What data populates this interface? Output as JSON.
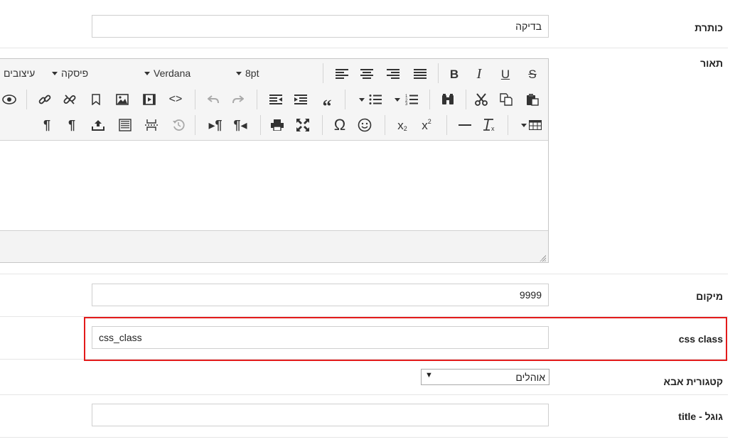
{
  "fields": {
    "title_label": "כותרת",
    "title_value": "בדיקה",
    "description_label": "תאור",
    "position_label": "מיקום",
    "position_value": "9999",
    "css_label": "css class",
    "css_value": "css_class",
    "parent_label": "קטגורית אבא",
    "parent_value": "אוהלים",
    "google_label": "גוגל - title",
    "google_value": ""
  },
  "editor": {
    "styles_combo": "עיצובים",
    "format_combo": "פיסקה",
    "font_combo": "Verdana",
    "size_combo": "8pt",
    "icons": {
      "subscript": "x",
      "subscript_small": "2",
      "superscript": "x",
      "superscript_small": "2"
    }
  },
  "colors": {
    "highlight_border": "#e31b1b",
    "toolbar_bg": "#f5f5f5"
  }
}
